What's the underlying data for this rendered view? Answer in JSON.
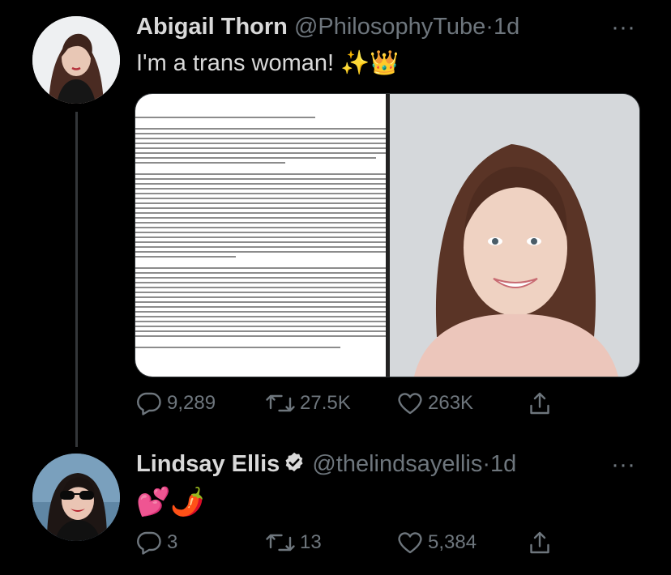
{
  "tweets": [
    {
      "name": "Abigail Thorn",
      "handle": "@PhilosophyTube",
      "dot": "·",
      "time": "1d",
      "text": "I'm a trans woman! ✨👑",
      "more": "···",
      "verified": false,
      "media": {
        "document_alt": "Statement document screenshot",
        "photo_alt": "Portrait photo"
      },
      "actions": {
        "replies": "9,289",
        "retweets": "27.5K",
        "likes": "263K"
      }
    },
    {
      "name": "Lindsay Ellis",
      "handle": "@thelindsayellis",
      "dot": "·",
      "time": "1d",
      "text": "💕🌶️",
      "more": "···",
      "verified": true,
      "actions": {
        "replies": "3",
        "retweets": "13",
        "likes": "5,384"
      }
    }
  ],
  "colors": {
    "background": "#000000",
    "primary_text": "#d9d9d9",
    "secondary_text": "#6e767d",
    "thread_line": "#333639",
    "verified": "#d9d9d9"
  },
  "icons": [
    "reply-icon",
    "retweet-icon",
    "like-icon",
    "share-icon",
    "more-icon",
    "verified-icon"
  ]
}
